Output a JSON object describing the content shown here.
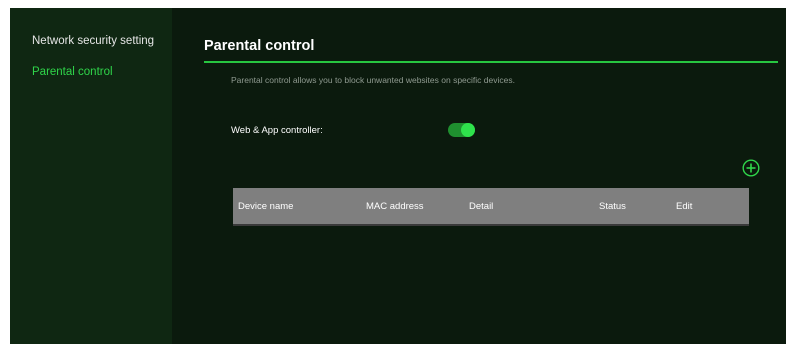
{
  "sidebar": {
    "items": [
      {
        "label": "Network security setting",
        "active": false
      },
      {
        "label": "Parental control",
        "active": true
      }
    ]
  },
  "page": {
    "title": "Parental control",
    "description": "Parental control allows you to block unwanted websites on specific devices."
  },
  "web_app_controller": {
    "label": "Web & App controller:",
    "enabled": true
  },
  "add_button": {
    "icon": "plus-circle-icon"
  },
  "table": {
    "columns": [
      "Device name",
      "MAC address",
      "Detail",
      "Status",
      "Edit"
    ],
    "rows": []
  },
  "colors": {
    "accent": "#2fd54a",
    "background": "#0b1a0d",
    "sidebar": "#0f2712",
    "table_header": "#7f7f7f"
  }
}
